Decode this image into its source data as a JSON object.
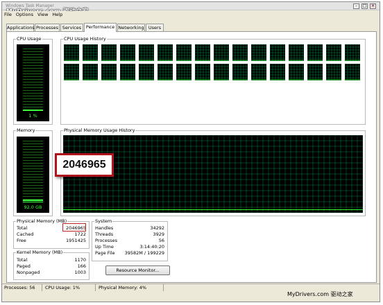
{
  "window": {
    "title": "Windows Task Manager",
    "watermark_top": "MyDrivers.com 驱动之家",
    "min_glyph": "–",
    "max_glyph": "□",
    "close_glyph": "×"
  },
  "menu": [
    "File",
    "Options",
    "View",
    "Help"
  ],
  "tabs": [
    "Applications",
    "Processes",
    "Services",
    "Performance",
    "Networking",
    "Users"
  ],
  "active_tab": "Performance",
  "cpu_usage": {
    "label": "CPU Usage",
    "value_text": "1 %",
    "percent": 1
  },
  "cpu_history": {
    "label": "CPU Usage History",
    "cores": 32
  },
  "memory": {
    "label": "Memory",
    "value_text": "92.0 GB",
    "percent": 4
  },
  "memory_history": {
    "label": "Physical Memory Usage History"
  },
  "physical_memory": {
    "label": "Physical Memory (MB)",
    "rows": [
      {
        "name": "Total",
        "value": "2046965"
      },
      {
        "name": "Cached",
        "value": "1722"
      },
      {
        "name": "Free",
        "value": "1951425"
      }
    ]
  },
  "kernel_memory": {
    "label": "Kernel Memory (MB)",
    "rows": [
      {
        "name": "Total",
        "value": "1170"
      },
      {
        "name": "Paged",
        "value": "166"
      },
      {
        "name": "Nonpaged",
        "value": "1003"
      }
    ]
  },
  "system": {
    "label": "System",
    "rows": [
      {
        "name": "Handles",
        "value": "34292"
      },
      {
        "name": "Threads",
        "value": "3929"
      },
      {
        "name": "Processes",
        "value": "56"
      },
      {
        "name": "Up Time",
        "value": "3:14:40:20"
      },
      {
        "name": "Page File",
        "value": "39582M / 199229"
      }
    ]
  },
  "callout": {
    "value": "2046965"
  },
  "resource_monitor_button": "Resource Monitor...",
  "status": {
    "processes": "Processes: 56",
    "cpu": "CPU Usage: 1%",
    "memory": "Physical Memory: 4%"
  },
  "watermark_bottom": "MyDrivers.com 驱动之家",
  "colors": {
    "graph_bg": "#000000",
    "grid": "#008040",
    "meter_on": "#31ff31",
    "callout_border": "#b1131a"
  },
  "icons": {
    "app": "task-manager-icon"
  }
}
